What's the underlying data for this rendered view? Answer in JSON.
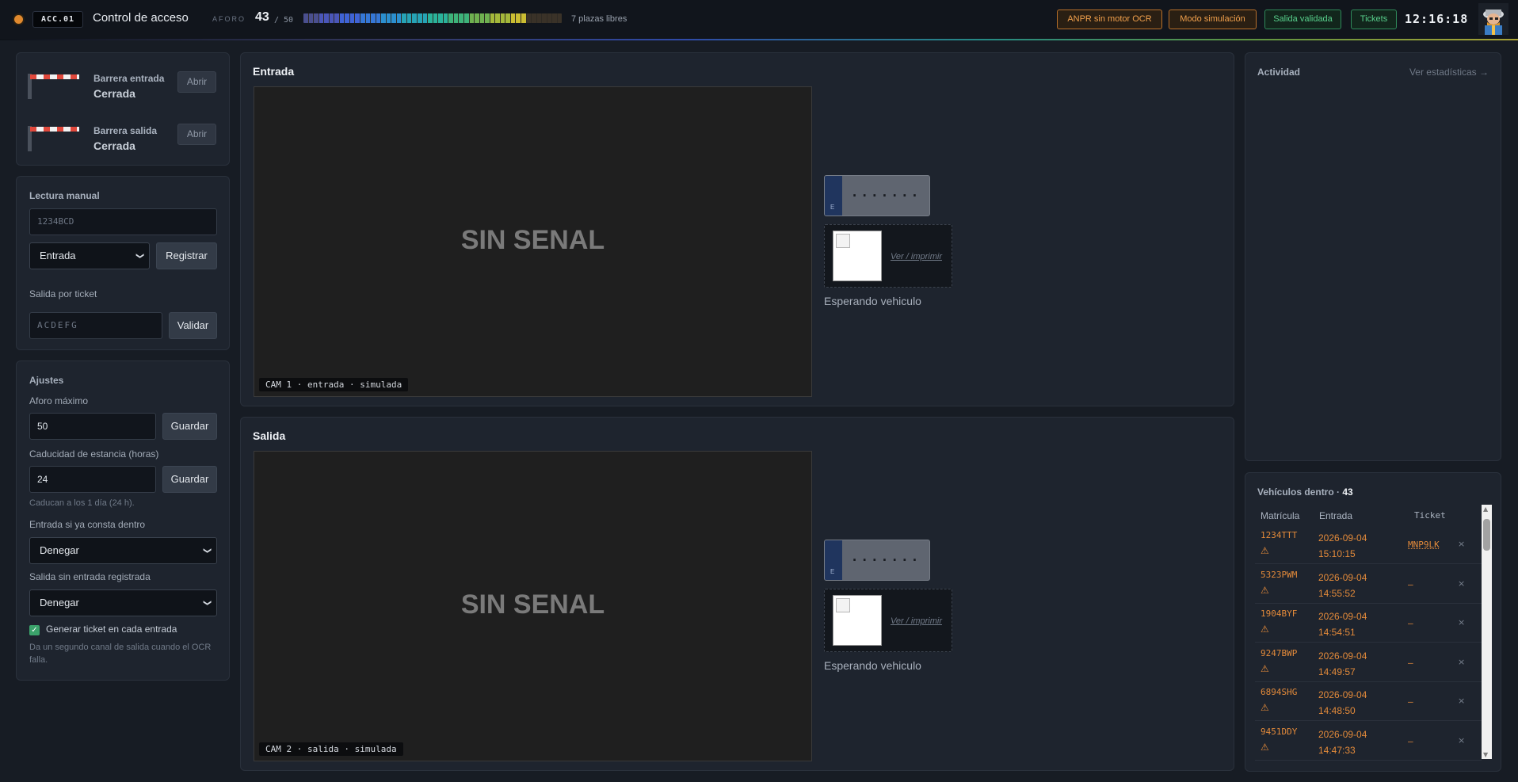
{
  "header": {
    "station_code": "ACC.01",
    "title": "Control de acceso",
    "aforo_label": "AFORO",
    "aforo_current": "43",
    "aforo_separator": "/ 50",
    "aforo_fraction": 0.86,
    "plazas_libres": "7 plazas libres",
    "chips": [
      "ANPR sin motor OCR",
      "Modo simulación",
      "Salida validada",
      "Tickets"
    ],
    "clock": "12:16:18"
  },
  "barriers": [
    {
      "name": "Barrera entrada",
      "state": "Cerrada",
      "action": "Abrir"
    },
    {
      "name": "Barrera salida",
      "state": "Cerrada",
      "action": "Abrir"
    }
  ],
  "manual": {
    "title": "Lectura manual",
    "plate_placeholder": "1234BCD",
    "direction": "Entrada",
    "register_label": "Registrar",
    "ticket_exit_label": "Salida por ticket",
    "ticket_placeholder": "ACDEFG",
    "validate_label": "Validar"
  },
  "settings": {
    "title": "Ajustes",
    "max_label": "Aforo máximo",
    "max_value": "50",
    "save_label": "Guardar",
    "expiry_label": "Caducidad de estancia (horas)",
    "expiry_value": "24",
    "expiry_hint": "Caducan a los 1 día (24 h).",
    "dup_entry_label": "Entrada si ya consta dentro",
    "dup_entry_value": "Denegar",
    "orphan_exit_label": "Salida sin entrada registrada",
    "orphan_exit_value": "Denegar",
    "ticket_checkbox_label": "Generar ticket en cada entrada",
    "ticket_checkbox_hint": "Da un segundo canal de salida cuando el OCR falla."
  },
  "lanes": [
    {
      "title": "Entrada",
      "no_signal": "SIN SENAL",
      "caption": "CAM 1 · entrada · simulada",
      "plate": "·······",
      "plate_country": "E",
      "ticket_link": "Ver / imprimir",
      "status": "Esperando vehiculo"
    },
    {
      "title": "Salida",
      "no_signal": "SIN SENAL",
      "caption": "CAM 2 · salida · simulada",
      "plate": "·······",
      "plate_country": "E",
      "ticket_link": "Ver / imprimir",
      "status": "Esperando vehiculo"
    }
  ],
  "activity": {
    "title": "Actividad",
    "stats_link": "Ver estadísticas →"
  },
  "vehicles": {
    "title": "Vehículos dentro ·",
    "count": "43",
    "columns": [
      "Matrícula",
      "Entrada",
      "Ticket"
    ],
    "rows": [
      {
        "plate": "1234TTT",
        "date": "2026-09-04",
        "time": "15:10:15",
        "ticket": "MNP9LK"
      },
      {
        "plate": "5323PWM",
        "date": "2026-09-04",
        "time": "14:55:52",
        "ticket": "—"
      },
      {
        "plate": "1904BYF",
        "date": "2026-09-04",
        "time": "14:54:51",
        "ticket": "—"
      },
      {
        "plate": "9247BWP",
        "date": "2026-09-04",
        "time": "14:49:57",
        "ticket": "—"
      },
      {
        "plate": "6894SHG",
        "date": "2026-09-04",
        "time": "14:48:50",
        "ticket": "—"
      },
      {
        "plate": "9451DDY",
        "date": "2026-09-04",
        "time": "14:47:33",
        "ticket": "—"
      }
    ],
    "warn_icon": "⚠",
    "remove_icon": "×"
  },
  "colors": {
    "accent_warn": "#e38a3a",
    "accent_ok": "#58d08c",
    "status_dot": "#e0892e"
  }
}
